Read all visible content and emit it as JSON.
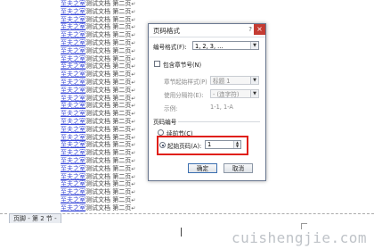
{
  "document": {
    "line_link_text": "至夫之室",
    "line_rest_text": "测试文档 第二页",
    "line_mark": "↵",
    "line_count": 27
  },
  "footer": {
    "tag": "页脚 - 第 2 节 -"
  },
  "watermark": "cuishengjie.com",
  "dialog": {
    "title": "页码格式",
    "help": "?",
    "close": "×",
    "number_format_label": "编号格式(F):",
    "number_format_value": "1, 2, 3, ...",
    "include_chapter_label": "包含章节号(N)",
    "chapter_style_label": "章节起始样式(P)",
    "chapter_style_value": "标题 1",
    "separator_label": "使用分隔符(E):",
    "separator_value": "- (连字符)",
    "example_label": "示例:",
    "example_value": "1-1, 1-A",
    "page_numbering_label": "页码编号",
    "continue_label": "续前节(C)",
    "start_at_label": "起始页码(A):",
    "start_at_value": "1",
    "ok": "确定",
    "cancel": "取消"
  }
}
